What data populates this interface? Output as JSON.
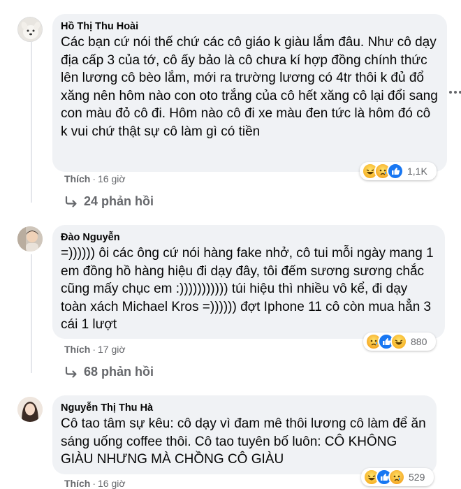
{
  "comments": [
    {
      "author": "Hồ Thị Thu Hoài",
      "text": "Các bạn cứ nói thế chứ các cô giáo k giàu lắm đâu. Như cô dạy địa cấp 3 của tớ, cô ấy bảo là cô chưa kí hợp đồng chính thức lên lương cô bèo lắm, mới ra trường lương có 4tr thôi k đủ đổ xăng nên hôm nào con oto trắng của cô hết xăng cô lại đổi sang con màu đỏ cô đi. Hôm nào cô đi xe màu đen tức là hôm đó cô k vui chứ thật sự cô làm gì có tiền",
      "like_label": "Thích",
      "time": "16 giờ",
      "reaction_count": "1,1K",
      "reactions": [
        "haha",
        "sad",
        "like"
      ],
      "replies_label": "24 phản hồi"
    },
    {
      "author": "Đào Nguyễn",
      "text": "=)))))) ôi các ông cứ nói hàng fake nhở, cô tui mỗi ngày mang 1 em đồng hồ hàng hiệu đi dạy đây, tôi đếm sương sương chắc cũng mấy chục em :))))))))))) túi hiệu thì nhiều vô kể, đi dạy toàn xách Michael Kros =)))))) đợt Iphone 11 cô còn mua hẳn 3 cái 1 lượt",
      "like_label": "Thích",
      "time": "17 giờ",
      "reaction_count": "880",
      "reactions": [
        "sad",
        "like",
        "haha"
      ],
      "replies_label": "68 phản hồi"
    },
    {
      "author": "Nguyễn Thị Thu Hà",
      "text": "Cô tao tâm sự kêu: cô dạy vì đam mê thôi lương cô làm để ăn sáng uống coffee thôi. Cô tao tuyên bố luôn: CÔ KHÔNG GIÀU NHƯNG MÀ CHỒNG CÔ GIÀU",
      "like_label": "Thích",
      "time": "16 giờ",
      "reaction_count": "529",
      "reactions": [
        "haha",
        "like",
        "sad"
      ]
    }
  ],
  "colors": {
    "bubble": "#f0f2f5",
    "secondary_text": "#65676b",
    "like_blue": "#1877f2",
    "emoji_yellow": "#f7b125"
  }
}
